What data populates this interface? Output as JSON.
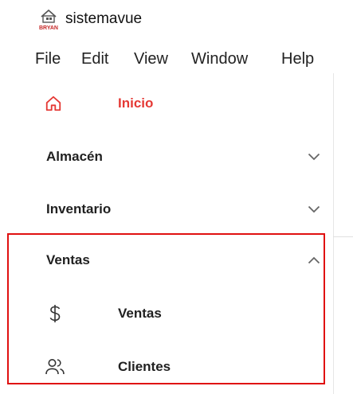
{
  "window": {
    "title": "sistemavue",
    "logo_text": "BRYAN"
  },
  "menu": [
    "File",
    "Edit",
    "View",
    "Window",
    "Help"
  ],
  "nav": {
    "home": {
      "label": "Inicio",
      "icon": "home-icon",
      "color": "#e53935"
    },
    "groups": [
      {
        "label": "Almacén",
        "expanded": false
      },
      {
        "label": "Inventario",
        "expanded": false
      },
      {
        "label": "Ventas",
        "expanded": true,
        "items": [
          {
            "label": "Ventas",
            "icon": "dollar-icon"
          },
          {
            "label": "Clientes",
            "icon": "users-icon"
          }
        ]
      }
    ]
  },
  "colors": {
    "active": "#e53935",
    "highlight_border": "#e01010"
  }
}
